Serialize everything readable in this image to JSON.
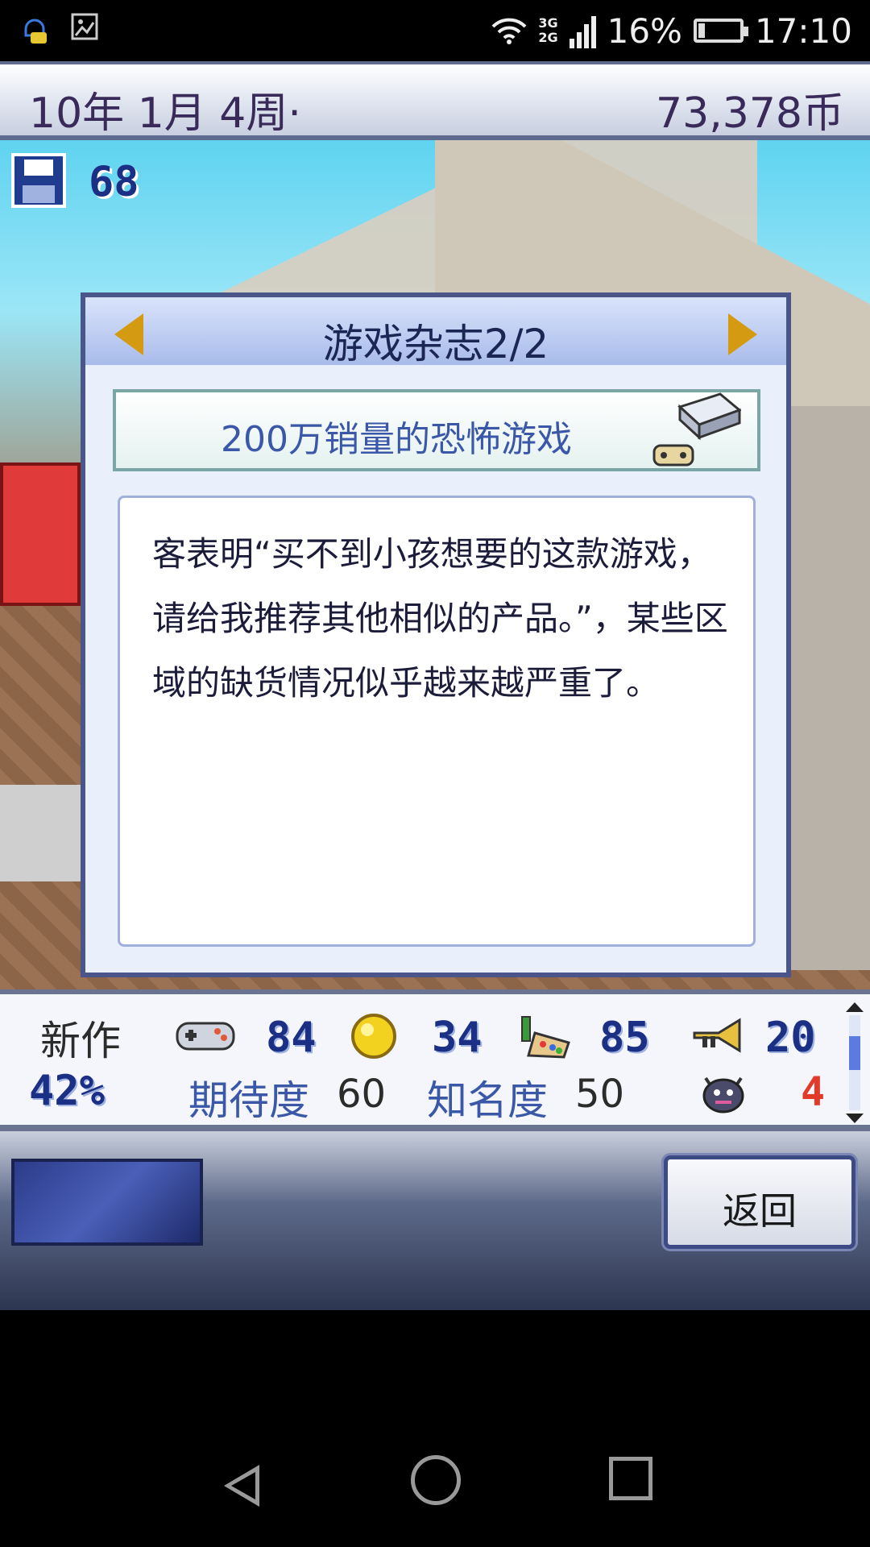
{
  "status_bar": {
    "network_top": "3G",
    "network_bottom": "2G",
    "battery": "16%",
    "battery_level": 0.16,
    "time": "17:10"
  },
  "top_bar": {
    "date": "10年 1月 4周·",
    "money": "73,378币"
  },
  "save": {
    "count": "68"
  },
  "dialog": {
    "title": "游戏杂志2/2",
    "subject": "200万销量的恐怖游戏",
    "body": "客表明“买不到小孩想要的这款游戏，请给我推荐其他相似的产品。”，某些区域的缺货情况似乎越来越严重了。"
  },
  "stats": {
    "new_label": "新作",
    "progress": "42%",
    "fun": "84",
    "creativity": "34",
    "graphics": "85",
    "sound": "20",
    "expectation_label": "期待度",
    "expectation": "60",
    "fame_label": "知名度",
    "fame": "50",
    "bugs": "4"
  },
  "toolbar": {
    "back_label": "返回"
  },
  "colors": {
    "title_text": "#1c2654",
    "pixel_number": "#1b2f85",
    "label_blue": "#3b57a8",
    "bug_red": "#e23a2a",
    "arrow_gold": "#d49a12"
  }
}
